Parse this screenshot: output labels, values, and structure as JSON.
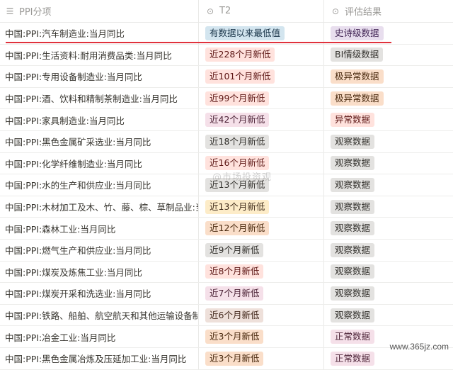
{
  "header": {
    "col1_label": "PPI分项",
    "col2_label": "T2",
    "col3_label": "评估结果",
    "col1_icon": "list-icon",
    "col2_icon": "circle-chevron-icon",
    "col3_icon": "circle-chevron-icon"
  },
  "rows": [
    {
      "name": "中国:PPI:汽车制造业:当月同比",
      "t2": "有数据以来最低值",
      "eval": "史诗级数据",
      "t2_bg": "#d3e5ef",
      "t2_fg": "#183347",
      "ev_bg": "#e8deee",
      "ev_fg": "#412454"
    },
    {
      "name": "中国:PPI:生活资料:耐用消费品类:当月同比",
      "t2": "近228个月新低",
      "eval": "BI情级数据",
      "t2_bg": "#ffe2dd",
      "t2_fg": "#5d1715",
      "ev_bg": "#e3e2e0",
      "ev_fg": "#32302c"
    },
    {
      "name": "中国:PPI:专用设备制造业:当月同比",
      "t2": "近101个月新低",
      "eval": "极异常数据",
      "t2_bg": "#ffe2dd",
      "t2_fg": "#5d1715",
      "ev_bg": "#fadec9",
      "ev_fg": "#49290e"
    },
    {
      "name": "中国:PPI:酒、饮料和精制茶制造业:当月同比",
      "t2": "近99个月新低",
      "eval": "极异常数据",
      "t2_bg": "#ffe2dd",
      "t2_fg": "#5d1715",
      "ev_bg": "#fadec9",
      "ev_fg": "#49290e"
    },
    {
      "name": "中国:PPI:家具制造业:当月同比",
      "t2": "近42个月新低",
      "eval": "异常数据",
      "t2_bg": "#f5e0e9",
      "t2_fg": "#4c2337",
      "ev_bg": "#ffe2dd",
      "ev_fg": "#5d1715"
    },
    {
      "name": "中国:PPI:黑色金属矿采选业:当月同比",
      "t2": "近18个月新低",
      "eval": "观察数据",
      "t2_bg": "#e3e2e0",
      "t2_fg": "#32302c",
      "ev_bg": "#e3e2e0",
      "ev_fg": "#32302c"
    },
    {
      "name": "中国:PPI:化学纤维制造业:当月同比",
      "t2": "近16个月新低",
      "eval": "观察数据",
      "t2_bg": "#ffe2dd",
      "t2_fg": "#5d1715",
      "ev_bg": "#e3e2e0",
      "ev_fg": "#32302c"
    },
    {
      "name": "中国:PPI:水的生产和供应业:当月同比",
      "t2": "近13个月新低",
      "eval": "观察数据",
      "t2_bg": "#e3e2e0",
      "t2_fg": "#32302c",
      "ev_bg": "#e3e2e0",
      "ev_fg": "#32302c"
    },
    {
      "name": "中国:PPI:木材加工及木、竹、藤、棕、草制品业:当",
      "t2": "近13个月新低",
      "eval": "观察数据",
      "t2_bg": "#fdecc8",
      "t2_fg": "#402c1b",
      "ev_bg": "#e3e2e0",
      "ev_fg": "#32302c"
    },
    {
      "name": "中国:PPI:森林工业:当月同比",
      "t2": "近12个月新低",
      "eval": "观察数据",
      "t2_bg": "#fadec9",
      "t2_fg": "#49290e",
      "ev_bg": "#e3e2e0",
      "ev_fg": "#32302c"
    },
    {
      "name": "中国:PPI:燃气生产和供应业:当月同比",
      "t2": "近9个月新低",
      "eval": "观察数据",
      "t2_bg": "#e3e2e0",
      "t2_fg": "#32302c",
      "ev_bg": "#e3e2e0",
      "ev_fg": "#32302c"
    },
    {
      "name": "中国:PPI:煤炭及炼焦工业:当月同比",
      "t2": "近8个月新低",
      "eval": "观察数据",
      "t2_bg": "#ffe2dd",
      "t2_fg": "#5d1715",
      "ev_bg": "#e3e2e0",
      "ev_fg": "#32302c"
    },
    {
      "name": "中国:PPI:煤炭开采和洗选业:当月同比",
      "t2": "近7个月新低",
      "eval": "观察数据",
      "t2_bg": "#f5e0e9",
      "t2_fg": "#4c2337",
      "ev_bg": "#e3e2e0",
      "ev_fg": "#32302c"
    },
    {
      "name": "中国:PPI:铁路、船舶、航空航天和其他运输设备制",
      "t2": "近6个月新低",
      "eval": "观察数据",
      "t2_bg": "#eee0da",
      "t2_fg": "#442a1e",
      "ev_bg": "#e3e2e0",
      "ev_fg": "#32302c"
    },
    {
      "name": "中国:PPI:冶金工业:当月同比",
      "t2": "近3个月新低",
      "eval": "正常数据",
      "t2_bg": "#fadec9",
      "t2_fg": "#49290e",
      "ev_bg": "#f5e0e9",
      "ev_fg": "#4c2337"
    },
    {
      "name": "中国:PPI:黑色金属冶炼及压延加工业:当月同比",
      "t2": "近3个月新低",
      "eval": "正常数据",
      "t2_bg": "#fadec9",
      "t2_fg": "#49290e",
      "ev_bg": "#f5e0e9",
      "ev_fg": "#4c2337"
    }
  ],
  "watermark_center": "@市场投资观",
  "watermark_corner": "www.365jz.com",
  "colors": {
    "highlight_line": "#e0323c"
  }
}
